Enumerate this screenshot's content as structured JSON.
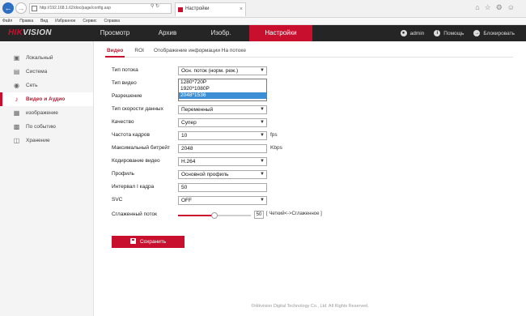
{
  "browser": {
    "address": "http://192.168.1.62/doc/page/config.asp",
    "tab_title": "Настройки",
    "menu": [
      "Файл",
      "Правка",
      "Вид",
      "Избранное",
      "Сервис",
      "Справка"
    ]
  },
  "header": {
    "logo_red": "HIK",
    "logo_white": "VISION",
    "nav": [
      "Просмотр",
      "Архив",
      "Изобр.",
      "Настройки"
    ],
    "user": "admin",
    "help": "Помощь",
    "lock": "Блокировать"
  },
  "sidebar": {
    "items": [
      {
        "label": "Локальный",
        "icon": "monitor-icon"
      },
      {
        "label": "Система",
        "icon": "system-icon"
      },
      {
        "label": "Сеть",
        "icon": "globe-icon"
      },
      {
        "label": "Видео и Аудио",
        "icon": "microphone-icon"
      },
      {
        "label": "изображение",
        "icon": "image-icon"
      },
      {
        "label": "По событию",
        "icon": "calendar-icon"
      },
      {
        "label": "Хранение",
        "icon": "storage-icon"
      }
    ],
    "active_index": 3
  },
  "subtabs": [
    "Видео",
    "ROI",
    "Отображение информации На потоке"
  ],
  "form": {
    "stream_type_label": "Тип потока",
    "stream_type_value": "Осн. поток (норм. реж.)",
    "video_type_label": "Тип видео",
    "resolution_label": "Разрешение",
    "resolution_options": [
      "1280*720P",
      "1920*1080P",
      "2048*1536"
    ],
    "resolution_selected": "2048*1536",
    "bitrate_type_label": "Тип скорости данных",
    "bitrate_type_value": "Переменный",
    "quality_label": "Качество",
    "quality_value": "Супер",
    "fps_label": "Частота кадров",
    "fps_value": "10",
    "fps_unit": "fps",
    "max_bitrate_label": "Максимальный битрейт",
    "max_bitrate_value": "2048",
    "max_bitrate_unit": "Kbps",
    "encoding_label": "Кодирование видео",
    "encoding_value": "H.264",
    "profile_label": "Профиль",
    "profile_value": "Основной профиль",
    "iframe_label": "Интервал I кадра",
    "iframe_value": "50",
    "svc_label": "SVC",
    "svc_value": "OFF",
    "smooth_label": "Сглаженный поток",
    "smooth_value": "50",
    "smooth_fraction": 0.5,
    "smooth_hint": "[ Четкий<->Сглаженное ]"
  },
  "save_label": "Сохранить",
  "footer": "©Hikvision Digital Technology Co., Ltd. All Rights Reserved.",
  "colors": {
    "accent": "#c8102e",
    "header_bg": "#252525",
    "selection": "#3c8fd4"
  }
}
